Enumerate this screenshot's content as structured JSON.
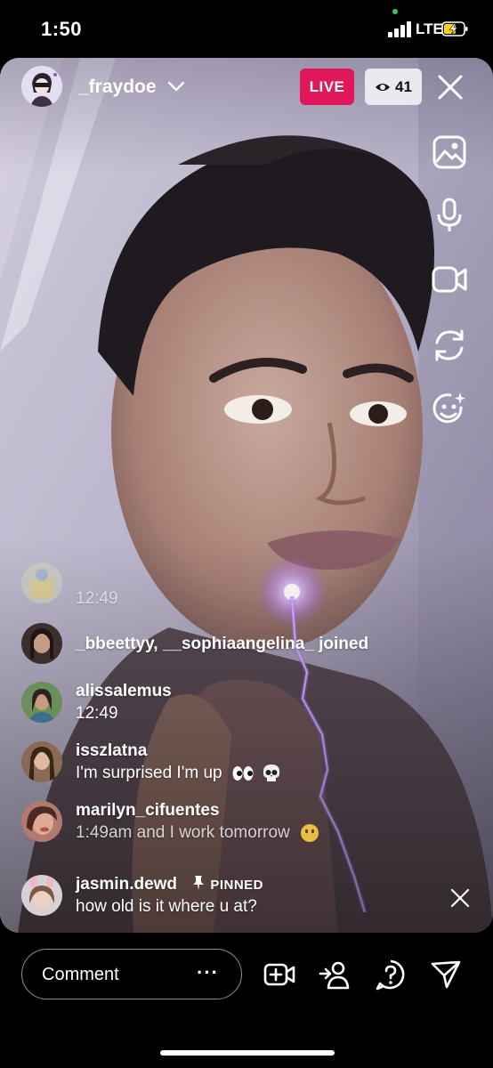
{
  "status_bar": {
    "time": "1:50",
    "network": "LTE"
  },
  "header": {
    "username": "_fraydoe",
    "live_label": "LIVE",
    "viewer_count": "41"
  },
  "toolbar": {
    "icons": [
      "gallery-icon",
      "microphone-icon",
      "video-camera-icon",
      "flip-camera-icon",
      "face-effects-icon"
    ]
  },
  "comments": [
    {
      "username": "",
      "text": "12:49"
    },
    {
      "username": "_bbeettyy, __sophiaangelina_ joined",
      "text": ""
    },
    {
      "username": "alissalemus",
      "text": "12:49"
    },
    {
      "username": "isszlatna",
      "text": "I'm surprised I'm up"
    },
    {
      "username": "marilyn_cifuentes",
      "text": "1:49am and I work tomorrow"
    }
  ],
  "pinned": {
    "username": "jasmin.dewd",
    "tag": "PINNED",
    "text": "how old is it where u at?"
  },
  "bottom_bar": {
    "comment_placeholder": "Comment",
    "more_label": "···"
  },
  "colors": {
    "live": "#e0185a",
    "background": "#000000"
  }
}
